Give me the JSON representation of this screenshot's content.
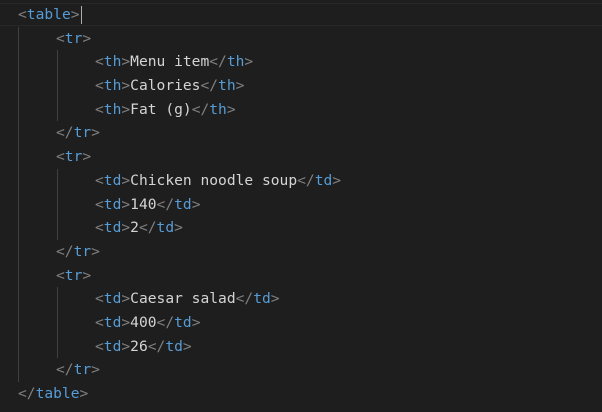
{
  "editor": {
    "lines": [
      {
        "indent": 0,
        "open": "table",
        "cursor": true
      },
      {
        "indent": 1,
        "open": "tr"
      },
      {
        "indent": 2,
        "open": "th",
        "text": "Menu item",
        "close": "th"
      },
      {
        "indent": 2,
        "open": "th",
        "text": "Calories",
        "close": "th"
      },
      {
        "indent": 2,
        "open": "th",
        "text": "Fat (g)",
        "close": "th"
      },
      {
        "indent": 1,
        "close": "tr"
      },
      {
        "indent": 1,
        "open": "tr"
      },
      {
        "indent": 2,
        "open": "td",
        "text": "Chicken noodle soup",
        "close": "td"
      },
      {
        "indent": 2,
        "open": "td",
        "text": "140",
        "close": "td"
      },
      {
        "indent": 2,
        "open": "td",
        "text": "2",
        "close": "td"
      },
      {
        "indent": 1,
        "close": "tr"
      },
      {
        "indent": 1,
        "open": "tr"
      },
      {
        "indent": 2,
        "open": "td",
        "text": "Caesar salad",
        "close": "td"
      },
      {
        "indent": 2,
        "open": "td",
        "text": "400",
        "close": "td"
      },
      {
        "indent": 2,
        "open": "td",
        "text": "26",
        "close": "td"
      },
      {
        "indent": 1,
        "close": "tr"
      },
      {
        "indent": 0,
        "close": "table"
      }
    ]
  },
  "theme": {
    "background": "#1e1e1e",
    "tag_color": "#569cd6",
    "bracket_color": "#808080",
    "text_color": "#d4d4d4",
    "indent_guide_color": "#404040"
  }
}
